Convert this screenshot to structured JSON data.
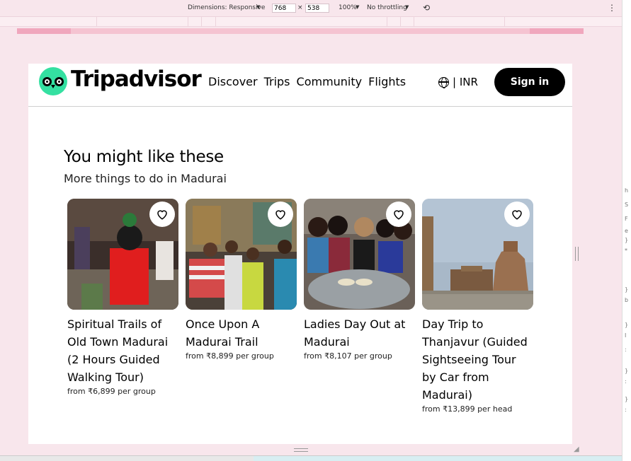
{
  "devtools": {
    "dimensions_label": "Dimensions: Responsive",
    "width": "768",
    "times": "×",
    "height": "538",
    "zoom": "100%",
    "throttling": "No throttling",
    "more": "⋮"
  },
  "header": {
    "logo_text": "Tripadvisor",
    "nav": [
      "Discover",
      "Trips",
      "Community",
      "Flights"
    ],
    "currency": "| INR",
    "signin": "Sign in"
  },
  "section": {
    "title": "You might like these",
    "subtitle": "More things to do in Madurai"
  },
  "cards": [
    {
      "title": "Spiritual Trails of Old Town Madurai (2 Hours Guided Walking Tour)",
      "price": "from ₹6,899 per group"
    },
    {
      "title": "Once Upon A Madurai Trail",
      "price": "from ₹8,899 per group"
    },
    {
      "title": "Ladies Day Out at Madurai",
      "price": "from ₹8,107 per group"
    },
    {
      "title": "Day Trip to Thanjavur (Guided Sightseeing Tour by Car from Madurai)",
      "price": "from ₹13,899 per head"
    }
  ],
  "colors": {
    "brand": "#34e0a1",
    "devtools_bg": "#f8e6ec"
  }
}
